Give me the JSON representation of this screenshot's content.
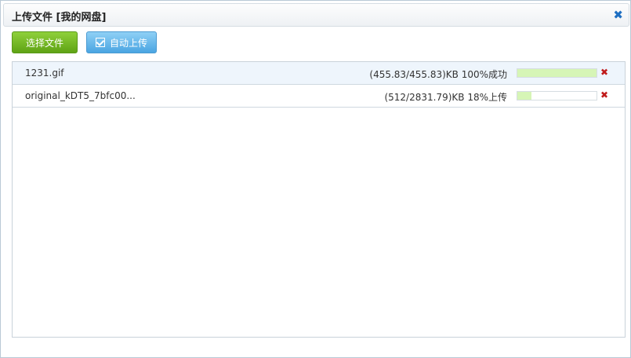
{
  "dialog": {
    "title": "上传文件 [我的网盘]",
    "close_label": "✖"
  },
  "toolbar": {
    "select_label": "选择文件",
    "auto_label": "自动上传",
    "auto_checked": true
  },
  "files": [
    {
      "name": "1231.gif",
      "status": "(455.83/455.83)KB 100%成功",
      "progress": 1.0,
      "delete": "✖"
    },
    {
      "name": "original_kDT5_7bfc00...",
      "status": "(512/2831.79)KB 18%上传",
      "progress": 0.18,
      "delete": "✖"
    }
  ]
}
